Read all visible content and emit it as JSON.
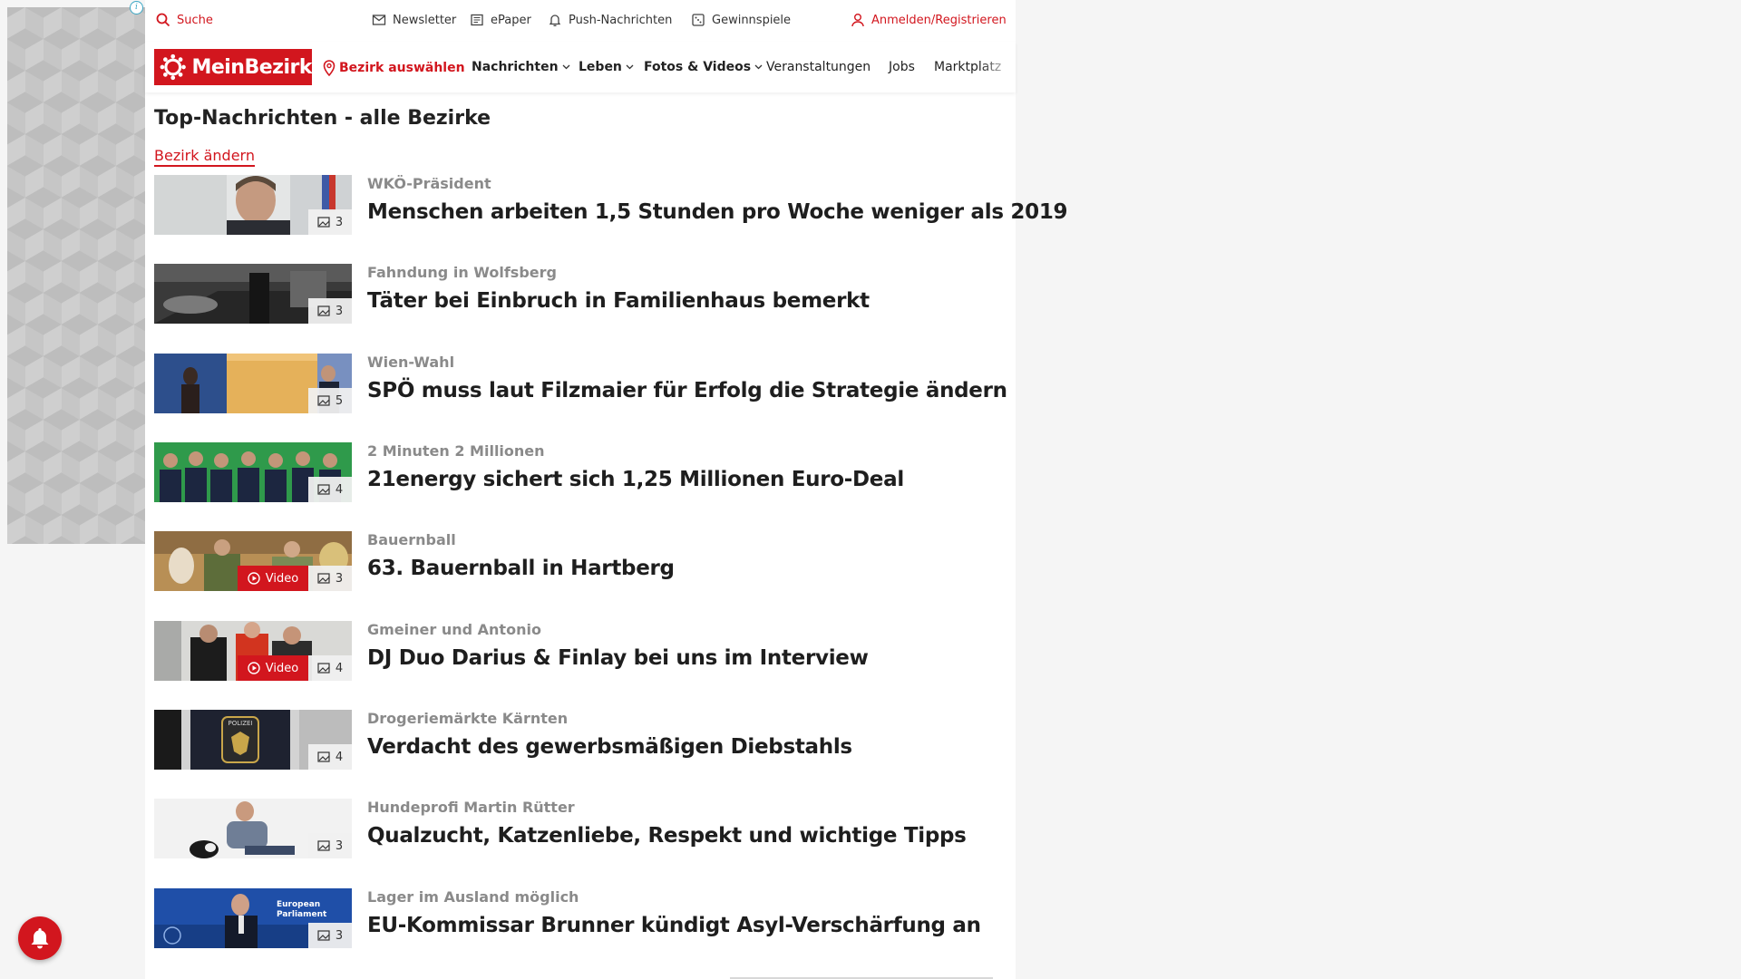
{
  "topbar": {
    "search_label": "Suche",
    "newsletter_label": "Newsletter",
    "epaper_label": "ePaper",
    "push_label": "Push-Nachrichten",
    "contests_label": "Gewinnspiele",
    "login_label": "Anmelden/Registrieren"
  },
  "nav": {
    "logo_text": "MeinBezirk",
    "district_select": "Bezirk auswählen",
    "items": [
      "Nachrichten",
      "Leben",
      "Fotos & Videos",
      "Veranstaltungen",
      "Jobs",
      "Marktplatz"
    ]
  },
  "main": {
    "title": "Top-Nachrichten - alle Bezirke",
    "change_district": "Bezirk ändern",
    "video_label": "Video",
    "articles": [
      {
        "kicker": "WKÖ-Präsident",
        "headline": "Menschen arbeiten 1,5 Stunden pro Woche weniger als 2019",
        "count": "3",
        "video": false
      },
      {
        "kicker": "Fahndung in Wolfsberg",
        "headline": "Täter bei Einbruch in Familienhaus bemerkt",
        "count": "3",
        "video": false
      },
      {
        "kicker": "Wien-Wahl",
        "headline": "SPÖ muss laut Filzmaier für Erfolg die Strategie ändern",
        "count": "5",
        "video": false
      },
      {
        "kicker": "2 Minuten 2 Millionen",
        "headline": "21energy sichert sich 1,25 Millionen Euro-Deal",
        "count": "4",
        "video": false
      },
      {
        "kicker": "Bauernball",
        "headline": "63. Bauernball in Hartberg",
        "count": "3",
        "video": true
      },
      {
        "kicker": "Gmeiner und Antonio",
        "headline": "DJ Duo Darius & Finlay bei uns im Interview",
        "count": "4",
        "video": true
      },
      {
        "kicker": "Drogeriemärkte Kärnten",
        "headline": "Verdacht des gewerbsmäßigen Diebstahls",
        "count": "4",
        "video": false
      },
      {
        "kicker": "Hundeprofi Martin Rütter",
        "headline": "Qualzucht, Katzenliebe, Respekt und wichtige Tipps",
        "count": "3",
        "video": false
      },
      {
        "kicker": "Lager im Ausland möglich",
        "headline": "EU-Kommissar Brunner kündigt Asyl-Verschärfung an",
        "count": "3",
        "video": false
      }
    ]
  },
  "thumb_text": {
    "polizei": "POLIZEI",
    "ep_line1": "European",
    "ep_line2": "Parliament"
  },
  "colors": {
    "brand_red": "#d2161e"
  }
}
